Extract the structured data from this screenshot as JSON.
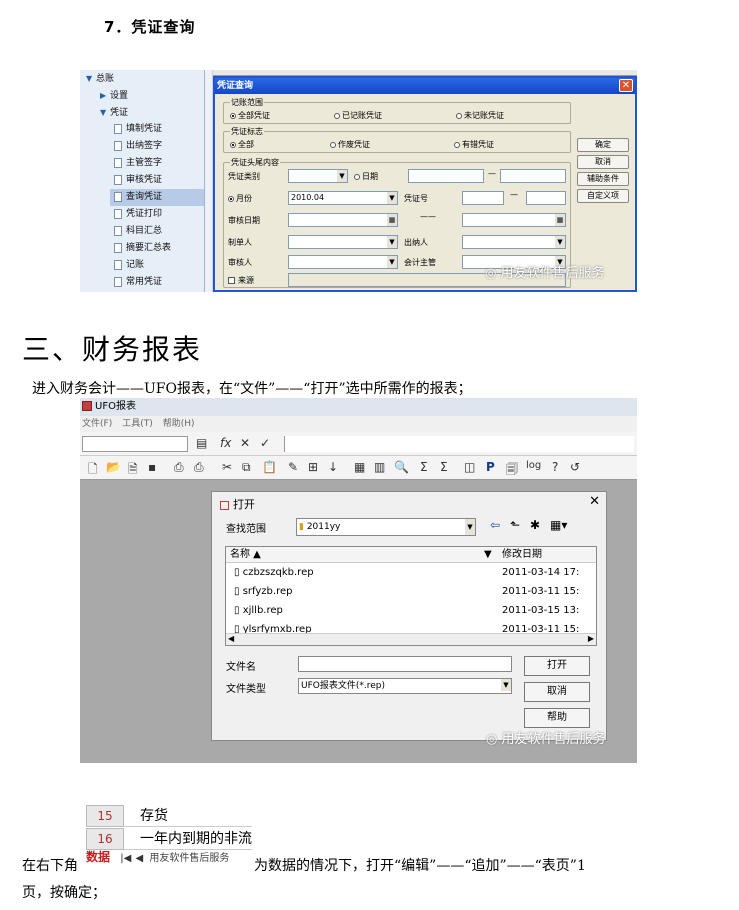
{
  "section7_heading": "7．凭证查询",
  "voucher_query": {
    "tree": {
      "root": "总账",
      "items": [
        "设置",
        "凭证",
        "填制凭证",
        "出纳签字",
        "主管签字",
        "审核凭证",
        "查询凭证",
        "凭证打印",
        "科目汇总",
        "摘要汇总表",
        "记账",
        "常用凭证"
      ],
      "selected": "查询凭证"
    },
    "dialog_title": "凭证查询",
    "group_range": {
      "label": "记账范围",
      "options": [
        "全部凭证",
        "已记账凭证",
        "未记账凭证"
      ],
      "selected": "全部凭证"
    },
    "group_flag": {
      "label": "凭证标志",
      "options": [
        "全部",
        "作废凭证",
        "有错凭证"
      ],
      "selected": "全部"
    },
    "group_head": {
      "label": "凭证头尾内容",
      "voucher_type_label": "凭证类别",
      "date_label": "日期",
      "period_label": "月份",
      "period_value": "2010.04",
      "voucher_no_label": "凭证号",
      "audit_date_label": "审核日期",
      "maker_label": "制单人",
      "cashier_label": "出纳人",
      "auditor_label": "审核人",
      "supervisor_label": "会计主管",
      "source_label": "来源"
    },
    "buttons": [
      "确定",
      "取消",
      "辅助条件",
      "自定义项"
    ],
    "watermark": "用友软件售后服务"
  },
  "section3_heading": "三、财务报表",
  "para_enter_ufo": "进入财务会计——UFO报表，在“文件”——“打开”选中所需作的报表；",
  "ufo": {
    "window_title": "UFO报表",
    "menu": [
      "文件(F)",
      "工具(T)",
      "帮助(H)"
    ],
    "open_dialog": {
      "title": "打开",
      "look_in_label": "查找范围",
      "look_in_value": "2011yy",
      "col_name": "名称 ▲",
      "col_date": "修改日期",
      "files": [
        {
          "name": "czbzszqkb.rep",
          "date": "2011-03-14 17:"
        },
        {
          "name": "srfyzb.rep",
          "date": "2011-03-11 15:"
        },
        {
          "name": "xjllb.rep",
          "date": "2011-03-15 13:"
        },
        {
          "name": "ylsrfymxb.rep",
          "date": "2011-03-11 15:"
        }
      ],
      "filename_label": "文件名",
      "filename_value": "",
      "filetype_label": "文件类型",
      "filetype_value": "UFO报表文件(*.rep)",
      "btn_open": "打开",
      "btn_cancel": "取消",
      "btn_help": "帮助"
    },
    "watermark": "用友软件售后服务"
  },
  "sheet": {
    "rows": [
      {
        "num": "15",
        "text": "存货"
      },
      {
        "num": "16",
        "text": "一年内到期的非流"
      }
    ],
    "tab": "数据",
    "watermark": "用友软件售后服务"
  },
  "para_bottom_left": "在右下角",
  "para_bottom_right": "为数据的情况下，打开“编辑”——“追加”——“表页”1",
  "para_bottom_line2": "页，按确定；"
}
